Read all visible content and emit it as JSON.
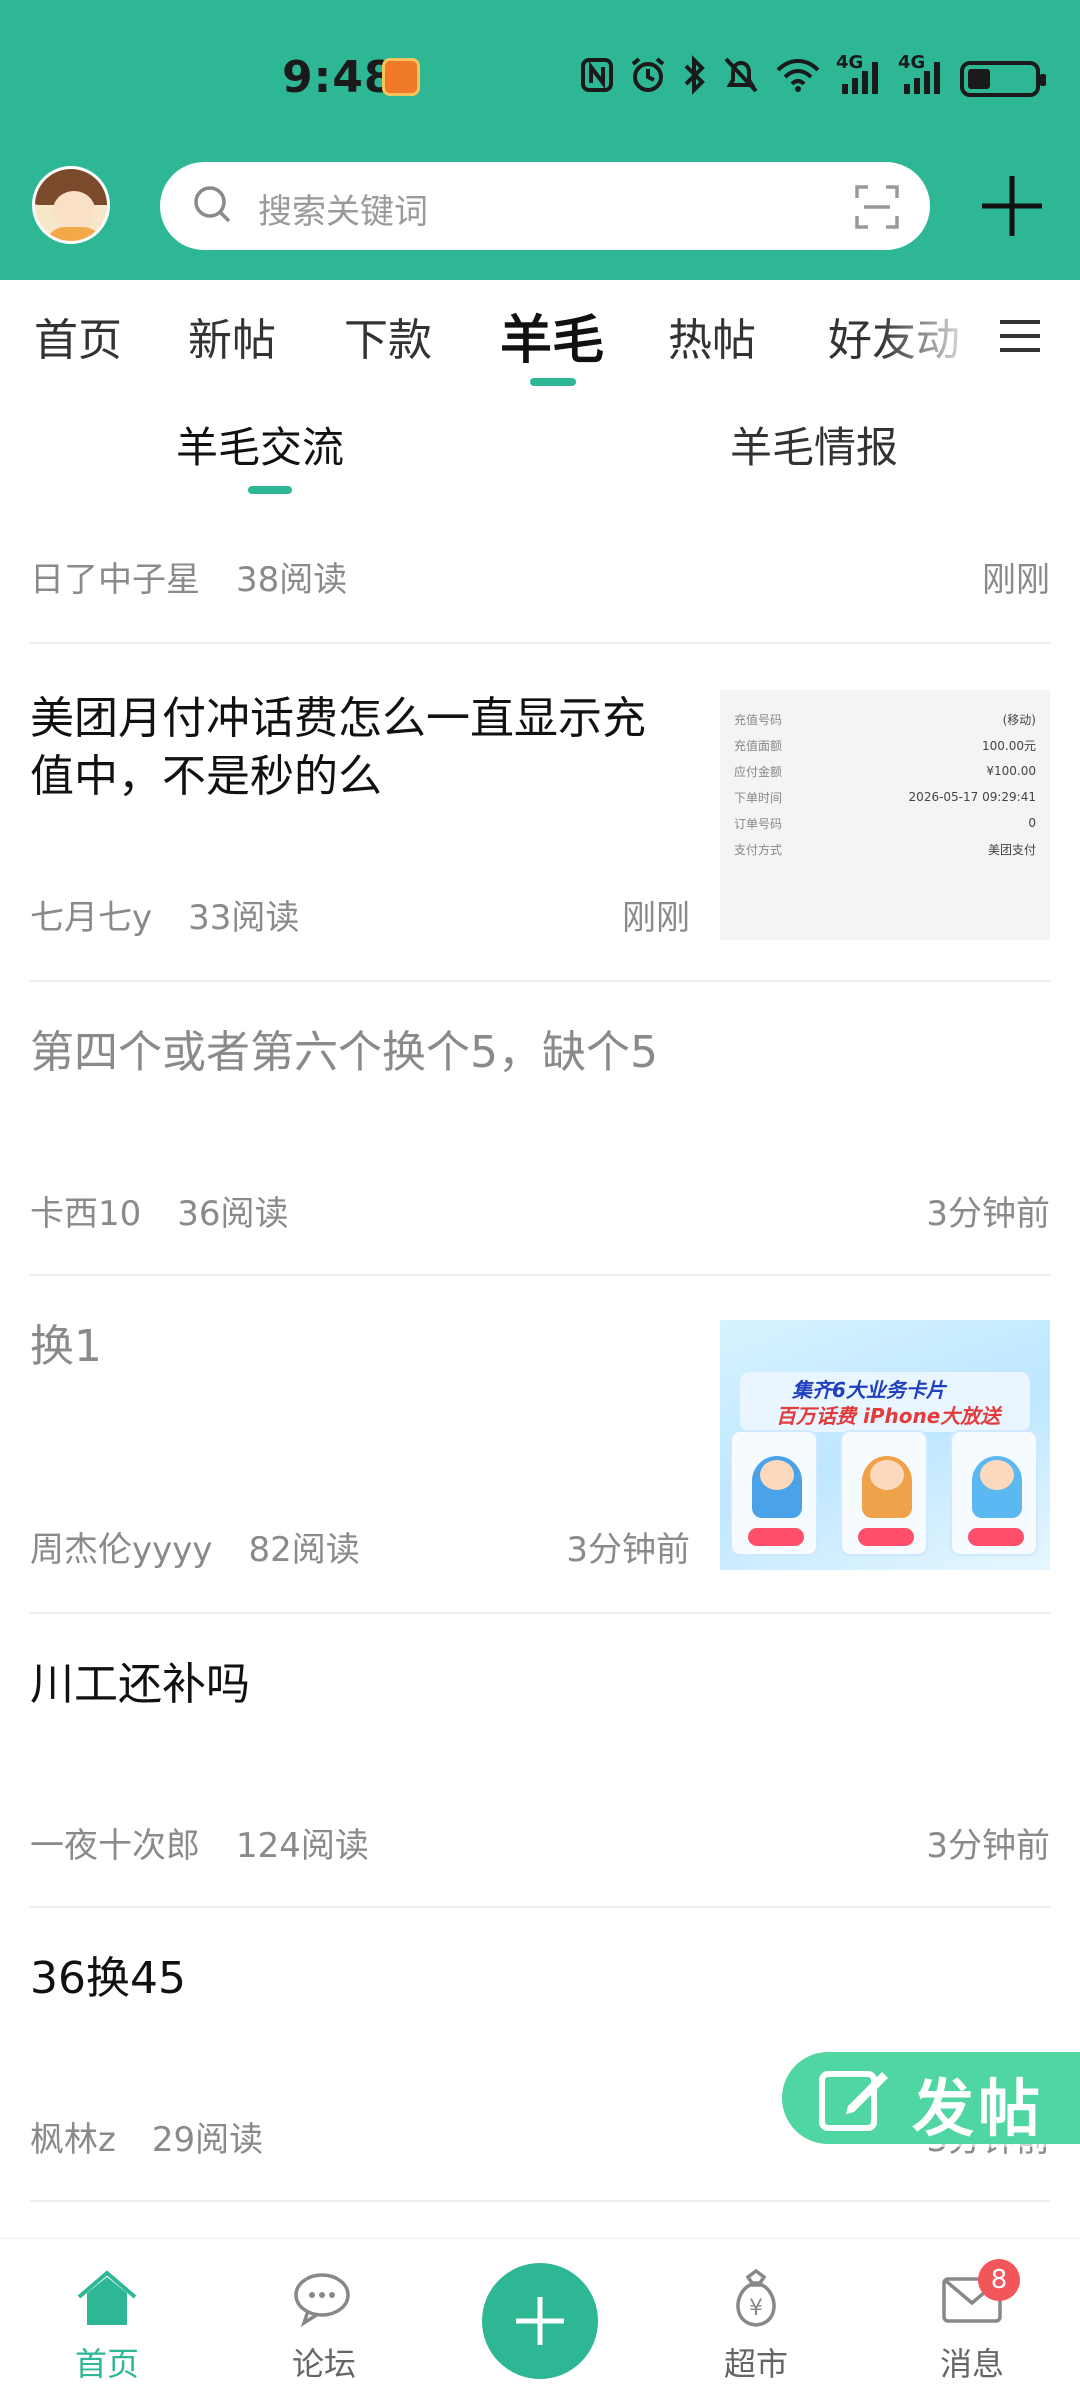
{
  "status_bar": {
    "time": "9:48",
    "network_1": "4G",
    "network_2": "4G"
  },
  "search": {
    "placeholder": "搜索关键词"
  },
  "top_tabs": [
    "首页",
    "新帖",
    "下款",
    "羊毛",
    "热帖",
    "好友动"
  ],
  "active_top_tab": "羊毛",
  "sub_tabs": [
    "羊毛交流",
    "羊毛情报"
  ],
  "active_sub_tab": "羊毛交流",
  "posts": [
    {
      "title": "",
      "author": "日了中子星",
      "reads": "38阅读",
      "time": "刚刚"
    },
    {
      "title": "美团月付冲话费怎么一直显示充值中，不是秒的么",
      "author": "七月七y",
      "reads": "33阅读",
      "time": "刚刚"
    },
    {
      "title": "第四个或者第六个换个5，缺个5",
      "author": "卡西10",
      "reads": "36阅读",
      "time": "3分钟前"
    },
    {
      "title": "换1",
      "author": "周杰伦yyyy",
      "reads": "82阅读",
      "time": "3分钟前"
    },
    {
      "title": "川工还补吗",
      "author": "一夜十次郎",
      "reads": "124阅读",
      "time": "3分钟前"
    },
    {
      "title": "36换45",
      "author": "枫林z",
      "reads": "29阅读",
      "time": "3分钟前"
    }
  ],
  "receipt_thumb": {
    "rows": [
      {
        "k": "充值号码",
        "v": "(移动)"
      },
      {
        "k": "充值面额",
        "v": "100.00元"
      },
      {
        "k": "应付金额",
        "v": "¥100.00"
      },
      {
        "k": "下单时间",
        "v": "2026-05-17 09:29:41"
      },
      {
        "k": "订单号码",
        "v": "0"
      },
      {
        "k": "支付方式",
        "v": "美团支付"
      }
    ]
  },
  "promo_thumb": {
    "line1": "集齐6大业务卡片",
    "line2": "百万话费 iPhone大放送"
  },
  "fab": {
    "label": "发帖"
  },
  "bottom_nav": {
    "home": "首页",
    "forum": "论坛",
    "market": "超市",
    "messages": "消息",
    "messages_badge": "8"
  },
  "colors": {
    "brand": "#2db795",
    "fab": "#4fd6a2",
    "badge": "#f2555a"
  }
}
